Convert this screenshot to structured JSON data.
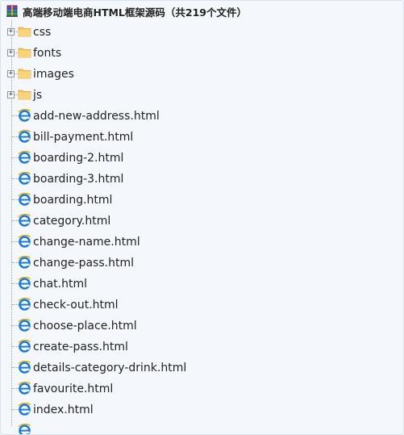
{
  "archive": {
    "icon": "winrar-archive-icon",
    "title": "高端移动端电商HTML框架源码（共219个文件）"
  },
  "folders": [
    {
      "label": "css",
      "icon": "folder-icon",
      "expander": "+"
    },
    {
      "label": "fonts",
      "icon": "folder-icon",
      "expander": "+"
    },
    {
      "label": "images",
      "icon": "folder-icon",
      "expander": "+"
    },
    {
      "label": "js",
      "icon": "folder-icon",
      "expander": "+"
    }
  ],
  "files": [
    {
      "label": "add-new-address.html",
      "icon": "ie-html-icon"
    },
    {
      "label": "bill-payment.html",
      "icon": "ie-html-icon"
    },
    {
      "label": "boarding-2.html",
      "icon": "ie-html-icon"
    },
    {
      "label": "boarding-3.html",
      "icon": "ie-html-icon"
    },
    {
      "label": "boarding.html",
      "icon": "ie-html-icon"
    },
    {
      "label": "category.html",
      "icon": "ie-html-icon"
    },
    {
      "label": "change-name.html",
      "icon": "ie-html-icon"
    },
    {
      "label": "change-pass.html",
      "icon": "ie-html-icon"
    },
    {
      "label": "chat.html",
      "icon": "ie-html-icon"
    },
    {
      "label": "check-out.html",
      "icon": "ie-html-icon"
    },
    {
      "label": "choose-place.html",
      "icon": "ie-html-icon"
    },
    {
      "label": "create-pass.html",
      "icon": "ie-html-icon"
    },
    {
      "label": "details-category-drink.html",
      "icon": "ie-html-icon"
    },
    {
      "label": "favourite.html",
      "icon": "ie-html-icon"
    },
    {
      "label": "index.html",
      "icon": "ie-html-icon"
    }
  ],
  "colors": {
    "folder": "#f5c55a",
    "ie_blue": "#1b7ad6",
    "background": "#f4f7fb"
  }
}
